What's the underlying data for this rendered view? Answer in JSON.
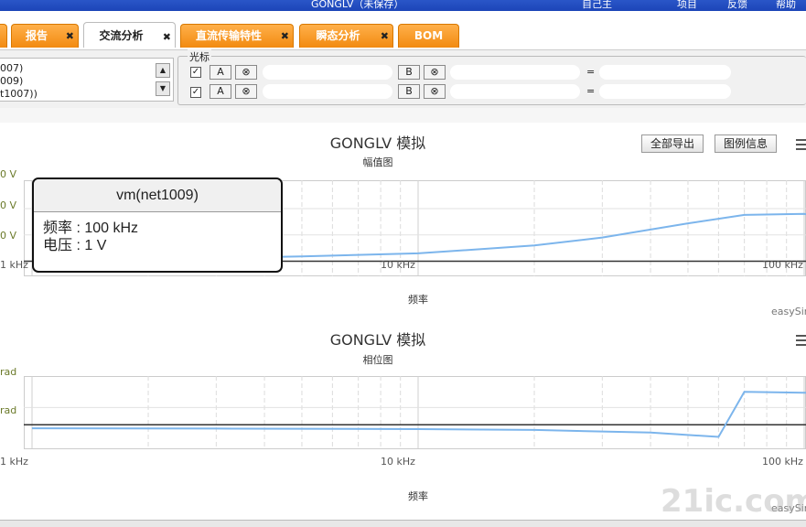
{
  "topbar": {
    "title": "GONGLV（未保存）",
    "menu": [
      "自己主",
      "项目",
      "反馈",
      "帮助"
    ]
  },
  "tabs": [
    {
      "label": "报告",
      "close": "✖"
    },
    {
      "label": "交流分析",
      "close": "✖"
    },
    {
      "label": "直流传输特性",
      "close": "✖"
    },
    {
      "label": "瞬态分析",
      "close": "✖"
    },
    {
      "label": "BOM"
    }
  ],
  "netlist": {
    "items": [
      "007)",
      "009)",
      "t1007))"
    ]
  },
  "cursor": {
    "legend": "光标",
    "checkbox_mark": "✓",
    "btn_a": "A",
    "btn_b": "B",
    "btn_clear": "⊗",
    "equals": "="
  },
  "charts": [
    {
      "title": "GONGLV 模拟",
      "subtitle": "幅值图",
      "xlabel": "频率",
      "export_label": "全部导出",
      "legend_label": "图例信息",
      "credit": "easySim",
      "xticks": [
        "1 kHz",
        "10 kHz",
        "100 kHz"
      ],
      "yticks": [
        "0 V",
        "0 V",
        "0 V"
      ]
    },
    {
      "title": "GONGLV 模拟",
      "subtitle": "相位图",
      "xlabel": "频率",
      "credit": "easySim",
      "xticks": [
        "1 kHz",
        "10 kHz",
        "100 kHz"
      ],
      "yticks": [
        "rad",
        "rad"
      ]
    }
  ],
  "tooltip": {
    "title": "vm(net1009)",
    "freq_label": "频率",
    "freq_value": "100 kHz",
    "volt_label": "电压",
    "volt_value": "1 V"
  },
  "watermark": "21ic.com",
  "colors": {
    "tab_orange": "#f28a10",
    "series": "#7cb5ec",
    "topbar": "#1c45b8"
  },
  "chart_data": [
    {
      "type": "line",
      "title": "GONGLV 模拟",
      "subtitle": "幅值图",
      "xlabel": "频率",
      "x_scale": "log",
      "x_unit": "kHz",
      "series": [
        {
          "x": [
            1,
            2,
            3,
            5,
            10,
            20,
            30,
            50,
            70,
            100,
            130
          ],
          "y": [
            0.02,
            0.04,
            0.06,
            0.09,
            0.15,
            0.3,
            0.45,
            0.72,
            0.88,
            0.9,
            0.78
          ]
        }
      ],
      "baseline": 0
    },
    {
      "type": "line",
      "title": "GONGLV 模拟",
      "subtitle": "相位图",
      "xlabel": "频率",
      "x_scale": "log",
      "x_unit": "kHz",
      "series": [
        {
          "x": [
            1,
            3,
            10,
            20,
            40,
            60,
            70,
            100,
            130
          ],
          "y": [
            -0.2,
            -0.22,
            -0.25,
            -0.3,
            -0.45,
            -0.7,
            1.9,
            1.85,
            1.78
          ]
        }
      ],
      "baseline": 0
    }
  ]
}
